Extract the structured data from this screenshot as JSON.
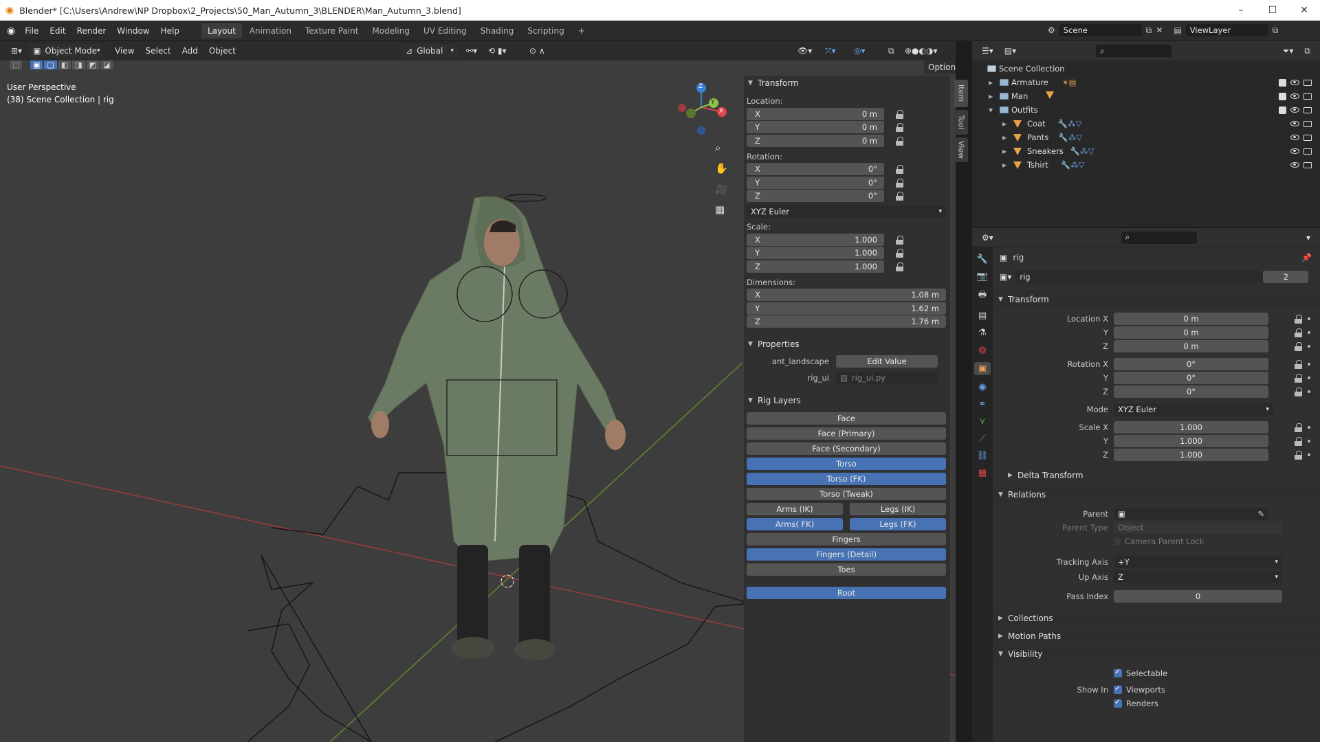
{
  "titlebar": {
    "title": "Blender* [C:\\Users\\Andrew\\NP Dropbox\\2_Projects\\50_Man_Autumn_3\\BLENDER\\Man_Autumn_3.blend]",
    "minimize": "–",
    "maximize": "☐",
    "close": "✕"
  },
  "menu": {
    "items": [
      "File",
      "Edit",
      "Render",
      "Window",
      "Help"
    ],
    "workspaces": [
      "Layout",
      "Animation",
      "Texture Paint",
      "Modeling",
      "UV Editing",
      "Shading",
      "Scripting"
    ],
    "add_tab": "+",
    "scene_label": "Scene",
    "viewlayer_label": "ViewLayer"
  },
  "viewport": {
    "mode": "Object Mode",
    "menus": [
      "View",
      "Select",
      "Add",
      "Object"
    ],
    "orientation": "Global",
    "options": "Options",
    "info_line1": "User Perspective",
    "info_line2": "(38) Scene Collection | rig",
    "gizmo_axes": {
      "x": "X",
      "y": "Y",
      "z": "Z"
    }
  },
  "npanel": {
    "transform_title": "Transform",
    "location_label": "Location:",
    "location": [
      {
        "axis": "X",
        "value": "0 m"
      },
      {
        "axis": "Y",
        "value": "0 m"
      },
      {
        "axis": "Z",
        "value": "0 m"
      }
    ],
    "rotation_label": "Rotation:",
    "rotation": [
      {
        "axis": "X",
        "value": "0°"
      },
      {
        "axis": "Y",
        "value": "0°"
      },
      {
        "axis": "Z",
        "value": "0°"
      }
    ],
    "rotation_mode": "XYZ Euler",
    "scale_label": "Scale:",
    "scale": [
      {
        "axis": "X",
        "value": "1.000"
      },
      {
        "axis": "Y",
        "value": "1.000"
      },
      {
        "axis": "Z",
        "value": "1.000"
      }
    ],
    "dimensions_label": "Dimensions:",
    "dimensions": [
      {
        "axis": "X",
        "value": "1.08 m"
      },
      {
        "axis": "Y",
        "value": "1.62 m"
      },
      {
        "axis": "Z",
        "value": "1.76 m"
      }
    ],
    "properties_title": "Properties",
    "prop1_label": "ant_landscape",
    "prop1_btn": "Edit Value",
    "prop2_label": "rig_ui",
    "prop2_value": "rig_ui.py",
    "riglayers_title": "Rig Layers",
    "layers": {
      "face": "Face",
      "face_primary": "Face (Primary)",
      "face_secondary": "Face (Secondary)",
      "torso": "Torso",
      "torso_fk": "Torso (FK)",
      "torso_tweak": "Torso (Tweak)",
      "arms_ik": "Arms (IK)",
      "legs_ik": "Legs (IK)",
      "arms_fk": "Arms( FK)",
      "legs_fk": "Legs (FK)",
      "fingers": "Fingers",
      "fingers_detail": "Fingers (Detail)",
      "toes": "Toes",
      "root": "Root"
    },
    "side_tabs": [
      "Item",
      "Tool",
      "View"
    ]
  },
  "outliner": {
    "root": "Scene Collection",
    "rows": [
      {
        "name": "Armature"
      },
      {
        "name": "Man"
      },
      {
        "name": "Outfits"
      },
      {
        "name": "Coat"
      },
      {
        "name": "Pants"
      },
      {
        "name": "Sneakers"
      },
      {
        "name": "Tshirt"
      }
    ]
  },
  "properties": {
    "object_name": "rig",
    "datablock_name": "rig",
    "users": "2",
    "transform_title": "Transform",
    "location_x_label": "Location X",
    "loc_x": "0 m",
    "loc_y": "0 m",
    "loc_z": "0 m",
    "rotation_x_label": "Rotation X",
    "rot_x": "0°",
    "rot_y": "0°",
    "rot_z": "0°",
    "y_label": "Y",
    "z_label": "Z",
    "mode_label": "Mode",
    "mode_value": "XYZ Euler",
    "scale_x_label": "Scale X",
    "scale_x": "1.000",
    "scale_y": "1.000",
    "scale_z": "1.000",
    "delta_title": "Delta Transform",
    "relations_title": "Relations",
    "parent_label": "Parent",
    "parent_type_label": "Parent Type",
    "parent_type_value": "Object",
    "camera_parent_lock": "Camera Parent Lock",
    "tracking_axis_label": "Tracking Axis",
    "tracking_axis_value": "+Y",
    "up_axis_label": "Up Axis",
    "up_axis_value": "Z",
    "pass_index_label": "Pass Index",
    "pass_index_value": "0",
    "collections_title": "Collections",
    "motion_paths_title": "Motion Paths",
    "visibility_title": "Visibility",
    "selectable": "Selectable",
    "show_in_label": "Show In",
    "viewports": "Viewports",
    "renders": "Renders"
  },
  "colors": {
    "accent": "#4772b3",
    "x_axis": "#e0454f",
    "y_axis": "#8bc34a",
    "z_axis": "#3b7fd9"
  }
}
